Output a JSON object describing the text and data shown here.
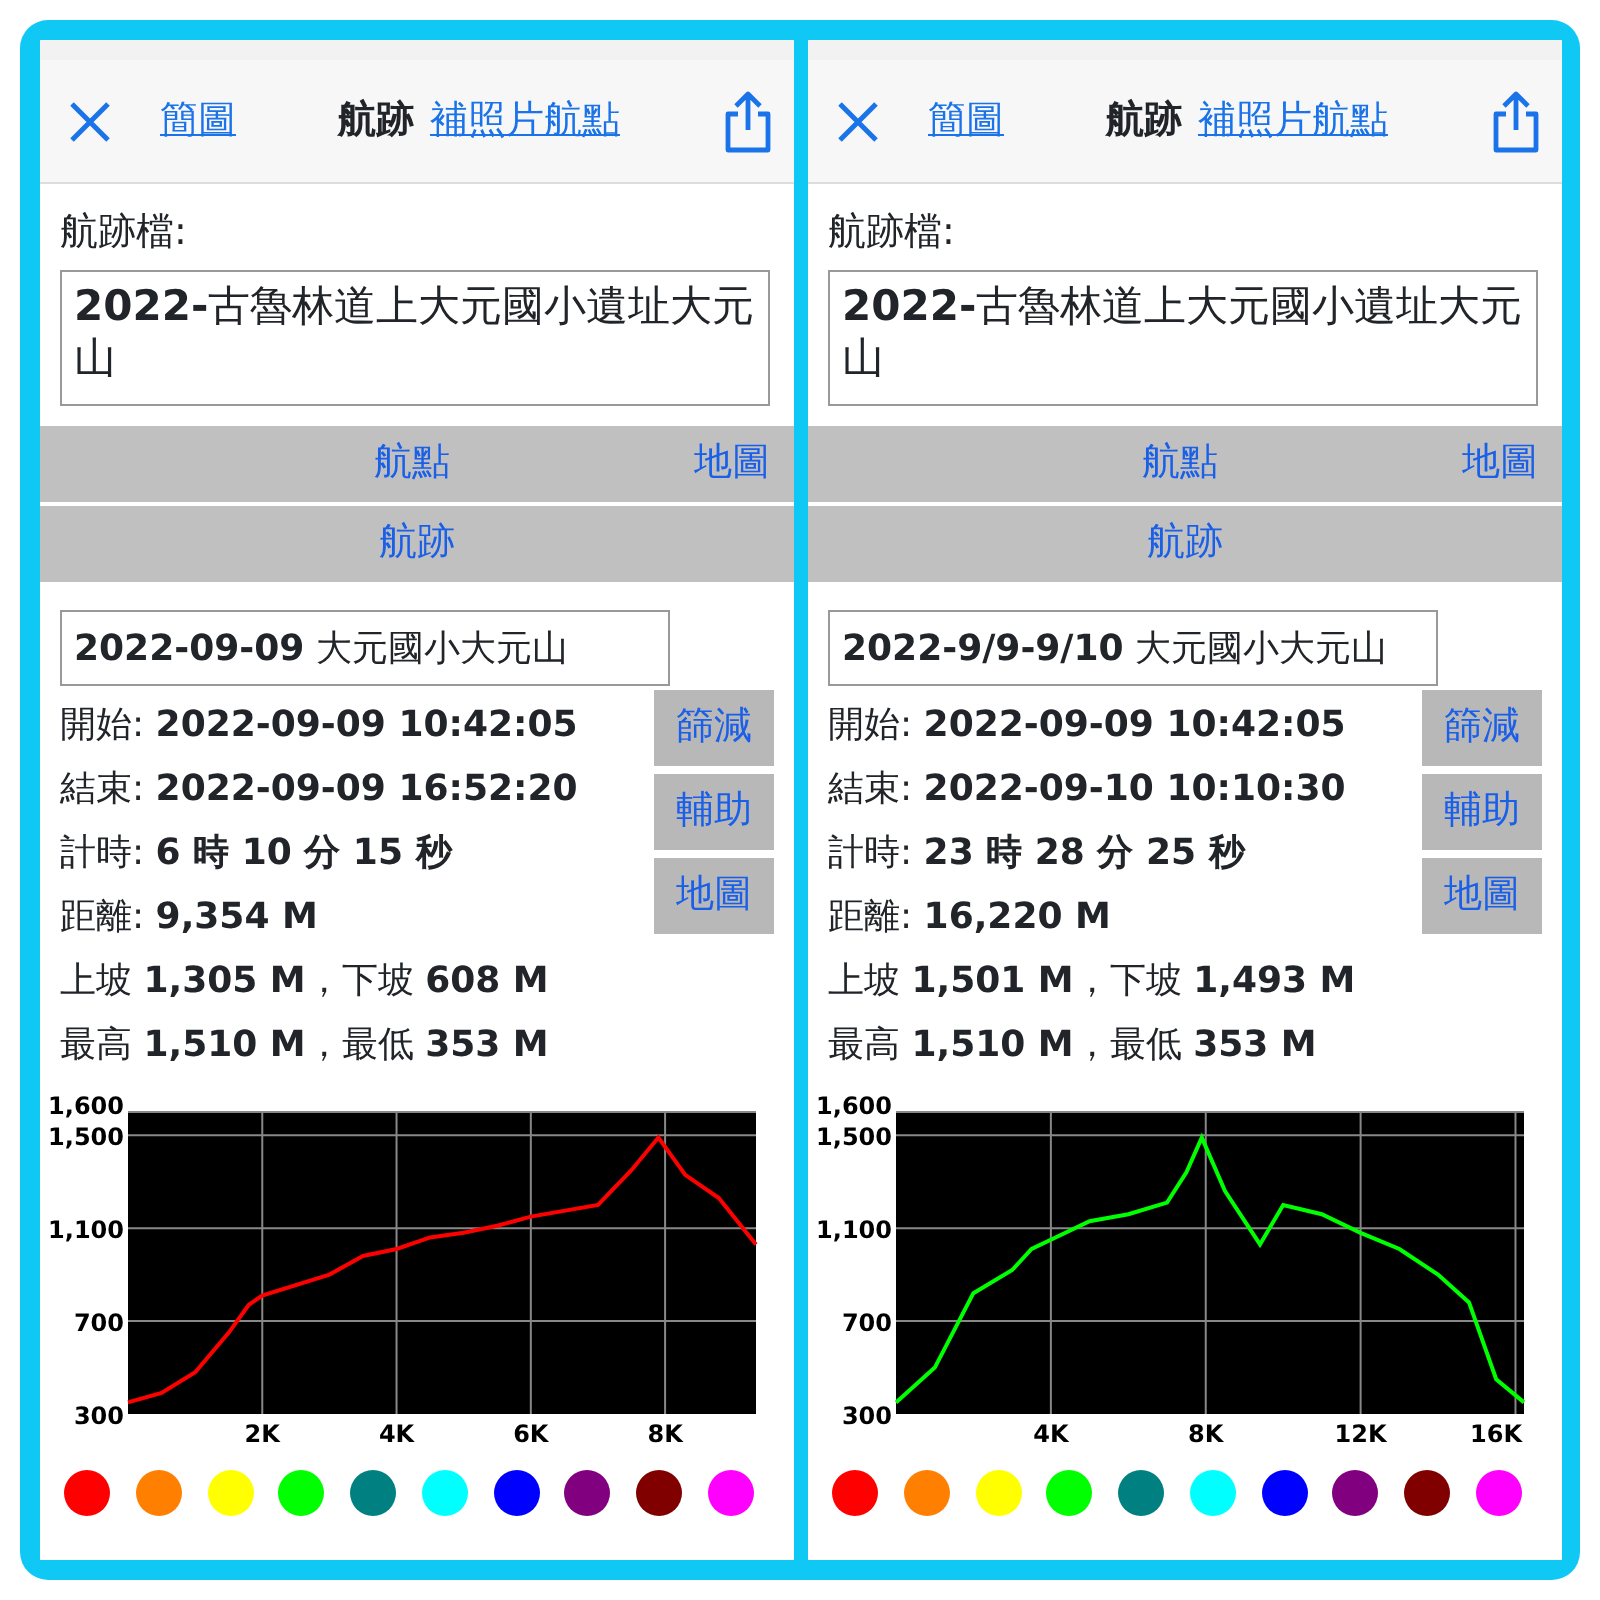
{
  "panels": [
    {
      "nav": {
        "left_link": "簡圖",
        "title": "航跡",
        "right_link": "補照片航點"
      },
      "file_label": "航跡檔:",
      "file_name": "**2022-**古魯林道上大元國小遺址大元山",
      "band_buttons": [
        "航點",
        "地圖"
      ],
      "track_button": "航跡",
      "track_name": "**2022-09-09** 大元國小大元山",
      "stats": [
        "開始: **2022-09-09 10:42:05**",
        "結束: **2022-09-09 16:52:20**",
        "計時: **6 時 10 分 15 秒**",
        "距離: **9,354 M**",
        "上坡 **1,305 M**，下坡 **608 M**",
        "最高 **1,510 M**，最低 **353 M**"
      ],
      "side_buttons": [
        "篩減",
        "輔助",
        "地圖"
      ],
      "chart_data": {
        "type": "line",
        "x": [
          0,
          500,
          1000,
          1500,
          1800,
          2000,
          3000,
          3500,
          4000,
          4500,
          5000,
          5500,
          6000,
          7000,
          7500,
          7900,
          8300,
          8800,
          9354
        ],
        "grid": true,
        "series": [
          {
            "color": "#ff0000",
            "values": [
              350,
              390,
              480,
              650,
              770,
              810,
              900,
              980,
              1010,
              1060,
              1080,
              1110,
              1150,
              1200,
              1350,
              1490,
              1330,
              1230,
              1030
            ]
          }
        ],
        "xlim": [
          0,
          9354
        ],
        "ylim": [
          300,
          1600
        ],
        "xticks": [
          {
            "value": 2000,
            "label": "2K"
          },
          {
            "value": 4000,
            "label": "4K"
          },
          {
            "value": 6000,
            "label": "6K"
          },
          {
            "value": 8000,
            "label": "8K"
          }
        ],
        "yticks": [
          {
            "value": 300,
            "label": "300"
          },
          {
            "value": 700,
            "label": "700"
          },
          {
            "value": 1100,
            "label": "1,100"
          },
          {
            "value": 1500,
            "label": "1,500"
          },
          {
            "value": 1600,
            "label": "1,600"
          }
        ]
      },
      "colors": [
        {
          "color": "#ff0000"
        },
        {
          "color": "#ff8000"
        },
        {
          "color": "#ffff00"
        },
        {
          "color": "#00ff00"
        },
        {
          "color": "#008080"
        },
        {
          "color": "#00ffff"
        },
        {
          "color": "#0000ff"
        },
        {
          "color": "#800080"
        },
        {
          "color": "#800000"
        },
        {
          "color": "#ff00ff"
        }
      ]
    },
    {
      "nav": {
        "left_link": "簡圖",
        "title": "航跡",
        "right_link": "補照片航點"
      },
      "file_label": "航跡檔:",
      "file_name": "**2022-**古魯林道上大元國小遺址大元山",
      "band_buttons": [
        "航點",
        "地圖"
      ],
      "track_button": "航跡",
      "track_name": "**2022-9/9-9/10** 大元國小大元山",
      "stats": [
        "開始: **2022-09-09 10:42:05**",
        "結束: **2022-09-10 10:10:30**",
        "計時: **23 時 28 分 25 秒**",
        "距離: **16,220 M**",
        "上坡 **1,501 M**，下坡 **1,493 M**",
        "最高 **1,510 M**，最低 **353 M**"
      ],
      "side_buttons": [
        "篩減",
        "輔助",
        "地圖"
      ],
      "chart_data": {
        "type": "line",
        "x": [
          0,
          1000,
          2000,
          3000,
          3500,
          4000,
          5000,
          6000,
          7000,
          7500,
          7900,
          8500,
          9400,
          10000,
          11000,
          12000,
          13000,
          14000,
          14800,
          15500,
          16220
        ],
        "grid": true,
        "series": [
          {
            "color": "#00ff00",
            "values": [
              350,
              500,
              820,
              920,
              1010,
              1050,
              1130,
              1160,
              1210,
              1340,
              1490,
              1260,
              1030,
              1200,
              1160,
              1080,
              1010,
              900,
              780,
              450,
              350
            ]
          }
        ],
        "xlim": [
          0,
          16220
        ],
        "ylim": [
          300,
          1600
        ],
        "xticks": [
          {
            "value": 4000,
            "label": "4K"
          },
          {
            "value": 8000,
            "label": "8K"
          },
          {
            "value": 12000,
            "label": "12K"
          },
          {
            "value": 16000,
            "label": "16K"
          }
        ],
        "yticks": [
          {
            "value": 300,
            "label": "300"
          },
          {
            "value": 700,
            "label": "700"
          },
          {
            "value": 1100,
            "label": "1,100"
          },
          {
            "value": 1500,
            "label": "1,500"
          },
          {
            "value": 1600,
            "label": "1,600"
          }
        ]
      },
      "colors": [
        {
          "color": "#ff0000"
        },
        {
          "color": "#ff8000"
        },
        {
          "color": "#ffff00"
        },
        {
          "color": "#00ff00"
        },
        {
          "color": "#008080"
        },
        {
          "color": "#00ffff"
        },
        {
          "color": "#0000ff"
        },
        {
          "color": "#800080"
        },
        {
          "color": "#800000"
        },
        {
          "color": "#ff00ff"
        }
      ]
    }
  ]
}
